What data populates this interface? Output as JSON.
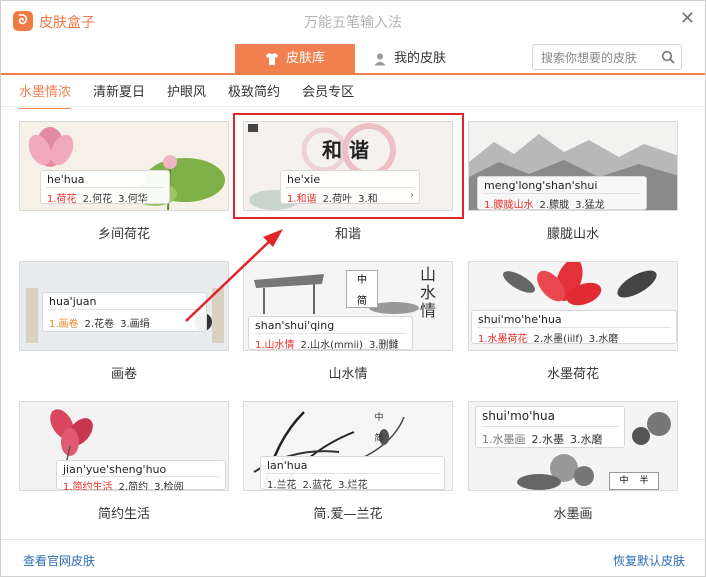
{
  "app": {
    "name": "皮肤盒子",
    "window_title": "万能五笔输入法"
  },
  "tabs": [
    {
      "label": "皮肤库",
      "active": true
    },
    {
      "label": "我的皮肤",
      "active": false
    }
  ],
  "search": {
    "placeholder": "搜索你想要的皮肤"
  },
  "categories": [
    {
      "label": "水墨情浓",
      "active": true
    },
    {
      "label": "清新夏日"
    },
    {
      "label": "护眼风"
    },
    {
      "label": "极致简约"
    },
    {
      "label": "会员专区"
    }
  ],
  "skins": [
    {
      "name": "乡间荷花",
      "pinyin": "he'hua",
      "candidates": [
        "1.荷花",
        "2.何花",
        "3.何华"
      ]
    },
    {
      "name": "和谐",
      "pinyin": "he'xie",
      "candidates": [
        "1.和谐",
        "2.荷叶",
        "3.和"
      ],
      "art_text": "和  谐",
      "selected": true
    },
    {
      "name": "朦胧山水",
      "pinyin": "meng'long'shan'shui",
      "candidates": [
        "1.朦胧山水",
        "2.朦胧",
        "3.猛龙"
      ]
    },
    {
      "name": "画卷",
      "pinyin": "hua'juan",
      "candidates": [
        "1.画卷",
        "2.花卷",
        "3.画绢"
      ]
    },
    {
      "name": "山水情",
      "pinyin": "shan'shui'qing",
      "candidates": [
        "1.山水情",
        "2.山水(mmii)",
        "3.删雠"
      ],
      "art_text": "山水情",
      "status": [
        "中",
        "简"
      ]
    },
    {
      "name": "水墨荷花",
      "pinyin": "shui'mo'he'hua",
      "candidates": [
        "1.水墨荷花",
        "2.水墨(iilf)",
        "3.水磨"
      ]
    },
    {
      "name": "简约生活",
      "pinyin": "jian'yue'sheng'huo",
      "candidates": [
        "1.简约生活",
        "2.简约",
        "3.检阅"
      ]
    },
    {
      "name": "简.爱—兰花",
      "pinyin": "lan'hua",
      "candidates": [
        "1.兰花",
        "2.蓝花",
        "3.烂花"
      ],
      "status": [
        "中",
        "简"
      ]
    },
    {
      "name": "水墨画",
      "pinyin": "shui'mo'hua",
      "candidates": [
        "1.水墨画",
        "2.水墨",
        "3.水磨"
      ],
      "status": [
        "中",
        "半"
      ]
    }
  ],
  "footer": {
    "left": "查看官网皮肤",
    "right": "恢复默认皮肤"
  },
  "colors": {
    "accent": "#f08050",
    "link": "#2b6cb5",
    "highlight_border": "#e0262a"
  }
}
